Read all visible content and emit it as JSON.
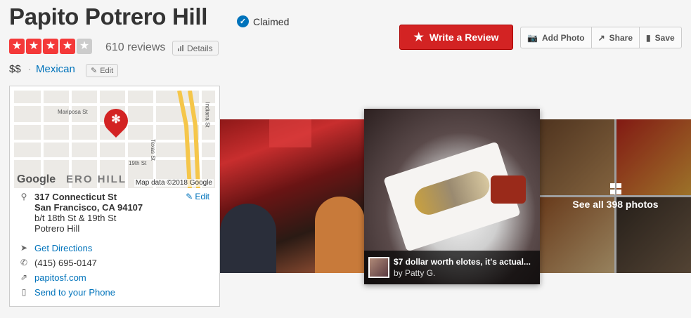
{
  "business": {
    "name": "Papito Potrero Hill",
    "claimed_label": "Claimed",
    "rating": 4,
    "rating_max": 5,
    "review_count": "610 reviews",
    "details_label": "Details",
    "price": "$$",
    "separator": "·",
    "category": "Mexican",
    "edit_label": "Edit"
  },
  "actions": {
    "write_review": "Write a Review",
    "add_photo": "Add Photo",
    "share": "Share",
    "save": "Save"
  },
  "map": {
    "attribution": "Map data ©2018 Google",
    "google_logo": "Google",
    "watermark": "ERO HILL",
    "streets": [
      "Mariposa St",
      "19th St",
      "Texas St",
      "Indiana St"
    ]
  },
  "address": {
    "line1": "317 Connecticut St",
    "line2": "San Francisco, CA 94107",
    "line3": "b/t 18th St & 19th St",
    "line4": "Potrero Hill",
    "edit_label": "Edit"
  },
  "contact": {
    "directions": "Get Directions",
    "phone": "(415) 695-0147",
    "website": "papitosf.com",
    "send_phone": "Send to your Phone"
  },
  "photos": {
    "see_all": "See all 398 photos",
    "caption_title": "$7 dollar worth elotes, it's actual...",
    "caption_by": "by Patty G."
  },
  "colors": {
    "brand_red": "#d32323",
    "link_blue": "#0073bb",
    "star_red": "#f43939"
  }
}
